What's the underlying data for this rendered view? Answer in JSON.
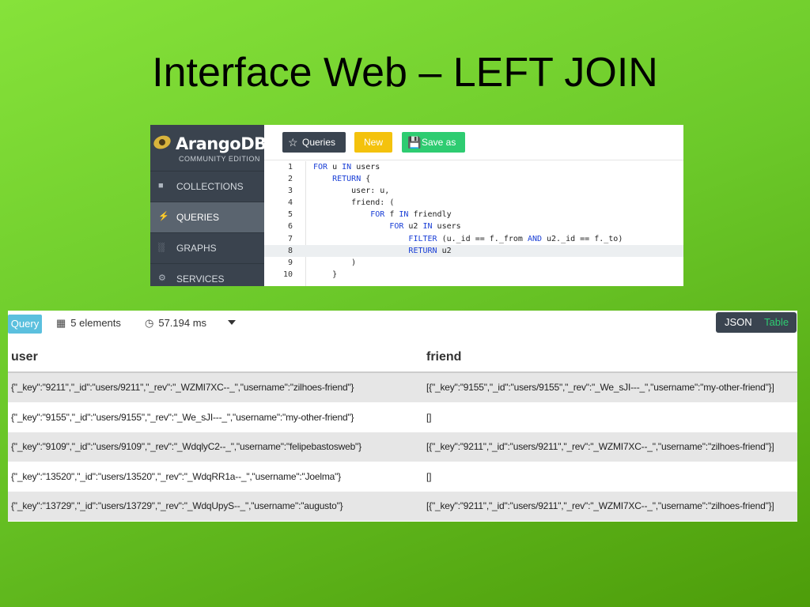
{
  "slide": {
    "title": "Interface Web – LEFT JOIN"
  },
  "arango": {
    "brand": "ArangoDB",
    "edition": "COMMUNITY EDITION",
    "nav": [
      {
        "label": "COLLECTIONS",
        "icon": "folder-icon",
        "active": false
      },
      {
        "label": "QUERIES",
        "icon": "bolt-icon",
        "active": true
      },
      {
        "label": "GRAPHS",
        "icon": "chart-icon",
        "active": false
      },
      {
        "label": "SERVICES",
        "icon": "gears-icon",
        "active": false
      }
    ],
    "toolbar": {
      "queries": "Queries",
      "new": "New",
      "save_as": "Save as"
    },
    "code": [
      {
        "n": "1",
        "text": "FOR u IN users"
      },
      {
        "n": "2",
        "text": "    RETURN {"
      },
      {
        "n": "3",
        "text": "        user: u,"
      },
      {
        "n": "4",
        "text": "        friend: ("
      },
      {
        "n": "5",
        "text": "            FOR f IN friendly"
      },
      {
        "n": "6",
        "text": "                FOR u2 IN users"
      },
      {
        "n": "7",
        "text": "                    FILTER (u._id == f._from AND u2._id == f._to)"
      },
      {
        "n": "8",
        "text": "                    RETURN u2"
      },
      {
        "n": "9",
        "text": "        )"
      },
      {
        "n": "10",
        "text": "    }"
      }
    ],
    "highlighted_line": "8"
  },
  "results": {
    "query_tab": "Query",
    "elements": "5 elements",
    "time": "57.194 ms",
    "view_json": "JSON",
    "view_table": "Table",
    "columns": [
      "user",
      "friend"
    ],
    "rows": [
      {
        "user": "{\"_key\":\"9211\",\"_id\":\"users/9211\",\"_rev\":\"_WZMI7XC--_\",\"username\":\"zilhoes-friend\"}",
        "friend": "[{\"_key\":\"9155\",\"_id\":\"users/9155\",\"_rev\":\"_We_sJI---_\",\"username\":\"my-other-friend\"}]"
      },
      {
        "user": "{\"_key\":\"9155\",\"_id\":\"users/9155\",\"_rev\":\"_We_sJI---_\",\"username\":\"my-other-friend\"}",
        "friend": "[]"
      },
      {
        "user": "{\"_key\":\"9109\",\"_id\":\"users/9109\",\"_rev\":\"_WdqlyC2--_\",\"username\":\"felipebastosweb\"}",
        "friend": "[{\"_key\":\"9211\",\"_id\":\"users/9211\",\"_rev\":\"_WZMI7XC--_\",\"username\":\"zilhoes-friend\"}]"
      },
      {
        "user": "{\"_key\":\"13520\",\"_id\":\"users/13520\",\"_rev\":\"_WdqRR1a--_\",\"username\":\"Joelma\"}",
        "friend": "[]"
      },
      {
        "user": "{\"_key\":\"13729\",\"_id\":\"users/13729\",\"_rev\":\"_WdqUpyS--_\",\"username\":\"augusto\"}",
        "friend": "[{\"_key\":\"9211\",\"_id\":\"users/9211\",\"_rev\":\"_WZMI7XC--_\",\"username\":\"zilhoes-friend\"}]"
      }
    ]
  }
}
